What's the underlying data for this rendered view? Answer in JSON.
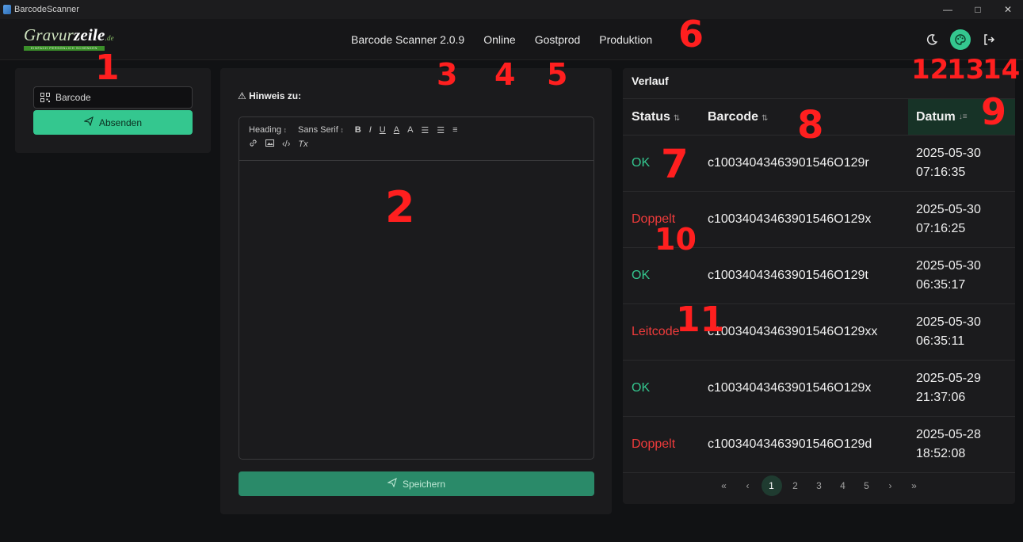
{
  "window": {
    "title": "BarcodeScanner",
    "controls": [
      "—",
      "□",
      "✕"
    ]
  },
  "logo": {
    "main": "Gravur",
    "bold": "zeile",
    "suffix": ".de",
    "tagline": "EINFACH PERSÖNLICH SCHENKEN"
  },
  "nav": {
    "app": "Barcode Scanner 2.0.9",
    "online": "Online",
    "gostprod": "Gostprod",
    "produktion": "Produktion"
  },
  "header_icons": {
    "theme": "moon-icon",
    "palette": "palette-icon",
    "logout": "logout-icon"
  },
  "left": {
    "barcode_placeholder": "Barcode",
    "send_label": "Absenden"
  },
  "middle": {
    "hint_title": "⚠ Hinweis zu:",
    "toolbar": {
      "heading": "Heading",
      "font": "Sans Serif",
      "bold": "B",
      "italic": "I",
      "underline": "U",
      "color": "A",
      "bg": "A",
      "ol": "☰",
      "ul": "☰",
      "align": "≡",
      "link": "✉",
      "image": "▣",
      "code": "‹/›",
      "clean": "Tx"
    },
    "save_label": "Speichern"
  },
  "history": {
    "title": "Verlauf",
    "columns": {
      "status": "Status",
      "barcode": "Barcode",
      "date": "Datum"
    },
    "rows": [
      {
        "status": "OK",
        "kind": "ok",
        "barcode": "c10034043463901546O129r",
        "date1": "2025-05-30",
        "date2": "07:16:35"
      },
      {
        "status": "Doppelt",
        "kind": "bad",
        "barcode": "c10034043463901546O129x",
        "date1": "2025-05-30",
        "date2": "07:16:25"
      },
      {
        "status": "OK",
        "kind": "ok",
        "barcode": "c10034043463901546O129t",
        "date1": "2025-05-30",
        "date2": "06:35:17"
      },
      {
        "status": "Leitcode",
        "kind": "bad",
        "barcode": "c10034043463901546O129xx",
        "date1": "2025-05-30",
        "date2": "06:35:11"
      },
      {
        "status": "OK",
        "kind": "ok",
        "barcode": "c10034043463901546O129x",
        "date1": "2025-05-29",
        "date2": "21:37:06"
      },
      {
        "status": "Doppelt",
        "kind": "bad",
        "barcode": "c10034043463901546O129d",
        "date1": "2025-05-28",
        "date2": "18:52:08"
      }
    ],
    "pager": {
      "first": "«",
      "prev": "‹",
      "pages": [
        "1",
        "2",
        "3",
        "4",
        "5"
      ],
      "current": "1",
      "next": "›",
      "last": "»"
    }
  },
  "annotations": [
    "1",
    "2",
    "3",
    "4",
    "5",
    "6",
    "7",
    "8",
    "9",
    "10",
    "11",
    "12",
    "13",
    "14"
  ]
}
